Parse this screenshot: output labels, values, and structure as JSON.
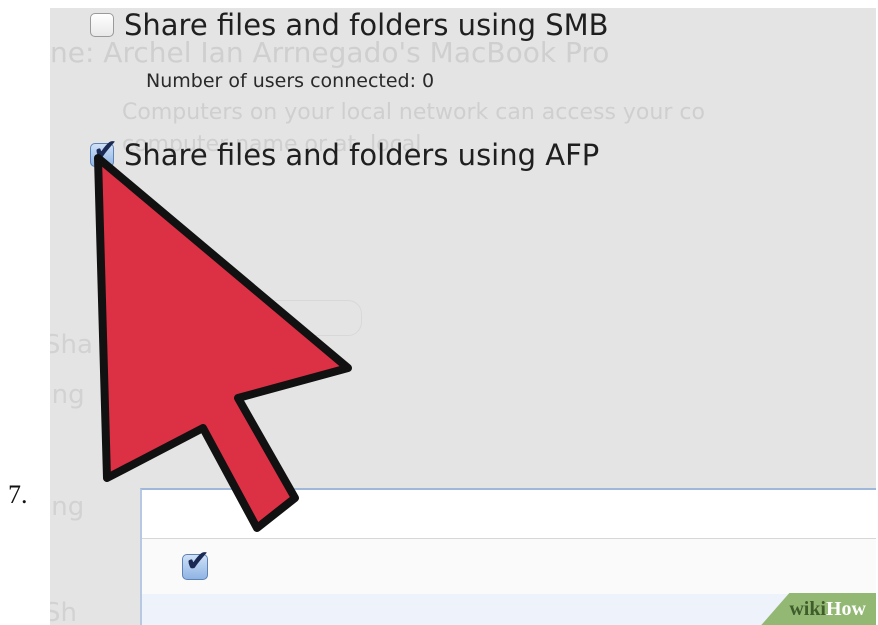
{
  "step_number": "7.",
  "faded_background": {
    "name_line": "ne:  Archel Ian Arrnegado's MacBook Pro",
    "desc_line": "Computers on your local network can access your co",
    "desc_line2": "computer name          or at      .local",
    "side_1": "Sha",
    "side_2": "Ing",
    "side_3": "ing",
    "side_4": "Sh"
  },
  "smb": {
    "label": "Share files and folders using SMB",
    "checked": false,
    "users_connected": "Number of users connected: 0"
  },
  "afp": {
    "label": "Share files and folders using AFP",
    "checked": true
  },
  "list_panel": {
    "row_checked": true
  },
  "watermark": {
    "part1": "wiki",
    "part2": "How"
  },
  "colors": {
    "cursor_fill": "#dc3045",
    "cursor_stroke": "#111111",
    "watermark_bg": "#93b874"
  },
  "icons": {
    "checkbox_checked": "checkmark-icon",
    "pointer": "arrow-cursor-icon"
  }
}
